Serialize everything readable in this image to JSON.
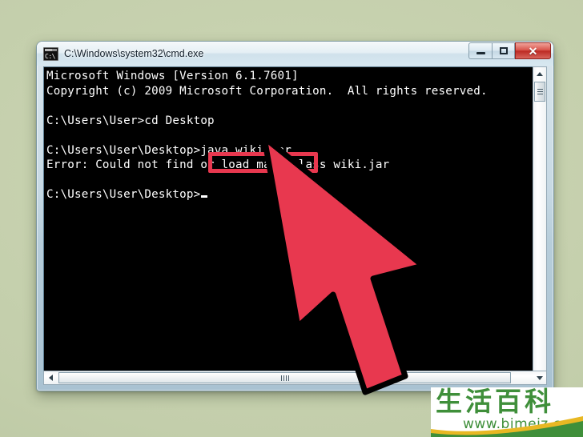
{
  "desktop": {
    "background_color": "#c3ceab"
  },
  "window": {
    "title": "C:\\Windows\\system32\\cmd.exe",
    "icon_name": "cmd-exe-icon",
    "icon_text": "C:\\",
    "controls": {
      "minimize_label": "Minimize",
      "maximize_label": "Maximize",
      "close_label": "✕"
    }
  },
  "console": {
    "lines": [
      "Microsoft Windows [Version 6.1.7601]",
      "Copyright (c) 2009 Microsoft Corporation.  All rights reserved.",
      "",
      "C:\\Users\\User>cd Desktop",
      "",
      "C:\\Users\\User\\Desktop>java wiki.jar",
      "Error: Could not find or load main class wiki.jar",
      "",
      "C:\\Users\\User\\Desktop>"
    ],
    "prompt_cursor": "_",
    "text_color": "#ffffff",
    "background_color": "#000000",
    "highlighted_command": "java wiki.jar",
    "highlight_color": "#e8384f"
  },
  "scrollbars": {
    "vertical": {
      "up_arrow": "scroll-up-arrow",
      "down_arrow": "scroll-down-arrow",
      "thumb": "vertical-scroll-thumb"
    },
    "horizontal": {
      "left_arrow": "scroll-left-arrow",
      "right_arrow": "scroll-right-arrow",
      "thumb": "horizontal-scroll-thumb"
    }
  },
  "cursor": {
    "type": "arrow-pointer",
    "fill_color": "#e8384f",
    "outline_color": "#000000"
  },
  "watermark": {
    "characters": "生活百科",
    "url": "www.bimeiz.com",
    "color": "#3f8f3a",
    "accent_color": "#e8b823"
  }
}
